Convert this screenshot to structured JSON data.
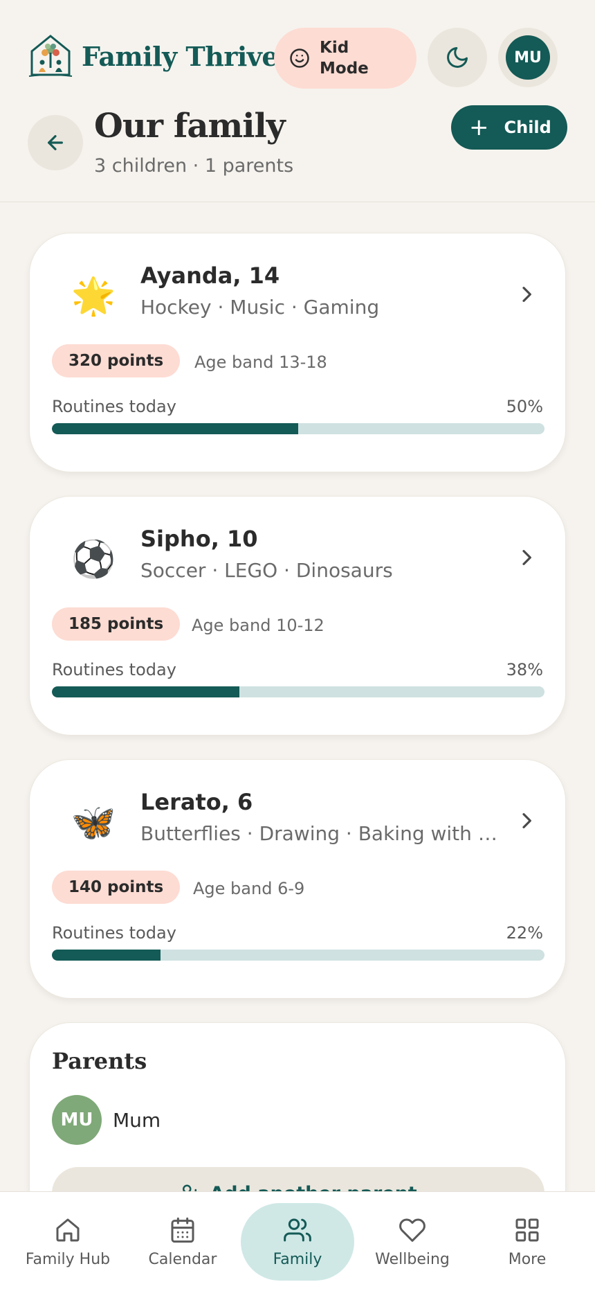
{
  "app": {
    "name": "Family Thrive",
    "kid_mode_label": "Kid Mode",
    "user_initials": "MU"
  },
  "page": {
    "title": "Our family",
    "subtitle": "3 children · 1 parents",
    "add_child_label": "Child"
  },
  "children": [
    {
      "emoji": "🌟",
      "name": "Ayanda, 14",
      "interests": "Hockey · Music · Gaming",
      "points": "320 points",
      "age_band": "Age band 13-18",
      "routines_label": "Routines today",
      "routines_pct_text": "50%",
      "routines_value": 50
    },
    {
      "emoji": "⚽",
      "name": "Sipho, 10",
      "interests": "Soccer · LEGO · Dinosaurs",
      "points": "185 points",
      "age_band": "Age band 10-12",
      "routines_label": "Routines today",
      "routines_pct_text": "38%",
      "routines_value": 38
    },
    {
      "emoji": "🦋",
      "name": "Lerato, 6",
      "interests": "Butterflies · Drawing · Baking with M...",
      "points": "140 points",
      "age_band": "Age band 6-9",
      "routines_label": "Routines today",
      "routines_pct_text": "22%",
      "routines_value": 22
    }
  ],
  "parents": {
    "title": "Parents",
    "items": [
      {
        "initials": "MU",
        "name": "Mum"
      }
    ],
    "add_label": "Add another parent"
  },
  "nav": {
    "items": [
      {
        "label": "Family Hub",
        "icon": "home-icon",
        "active": false
      },
      {
        "label": "Calendar",
        "icon": "calendar-icon",
        "active": false
      },
      {
        "label": "Family",
        "icon": "users-icon",
        "active": true
      },
      {
        "label": "Wellbeing",
        "icon": "heart-icon",
        "active": false
      },
      {
        "label": "More",
        "icon": "grid-icon",
        "active": false
      }
    ]
  },
  "colors": {
    "brand": "#145a56",
    "accent_pink": "#fddcd3",
    "progress_track": "#cfe1e1",
    "background": "#f6f3ee",
    "parent_avatar": "#7fa978"
  }
}
